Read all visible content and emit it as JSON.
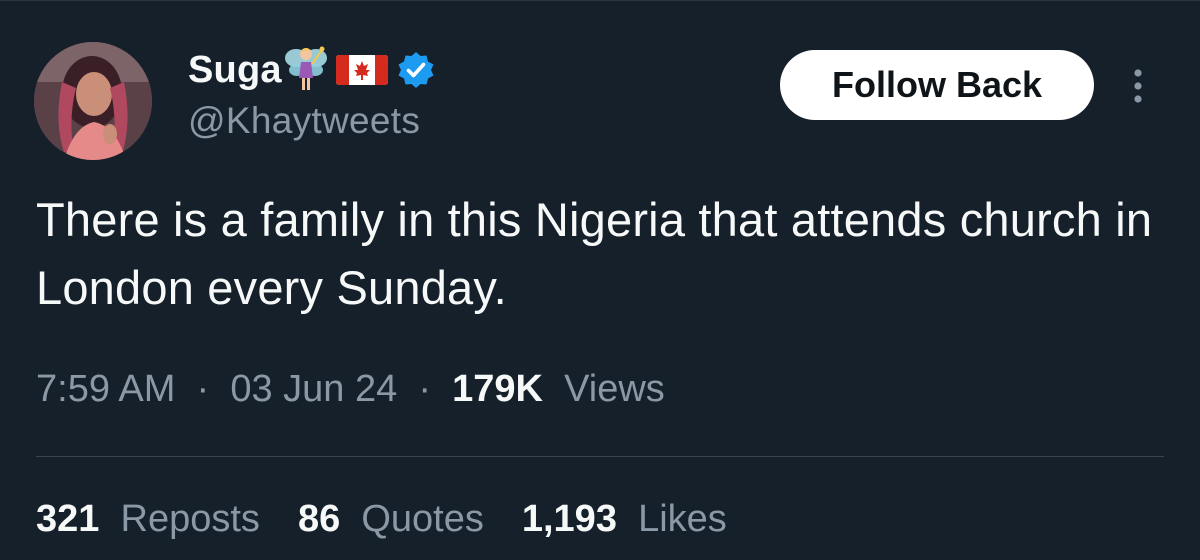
{
  "user": {
    "display_name": "Suga",
    "handle": "@Khaytweets",
    "emoji_icons": [
      "fairy-icon",
      "canada-flag-icon"
    ],
    "verified": true
  },
  "actions": {
    "follow_label": "Follow Back"
  },
  "tweet": {
    "text": "There is a family in this Nigeria that attends church in London every Sunday."
  },
  "meta": {
    "time": "7:59 AM",
    "separator": "·",
    "date": "03 Jun 24",
    "views_count": "179K",
    "views_label": "Views"
  },
  "stats": {
    "reposts_count": "321",
    "reposts_label": "Reposts",
    "quotes_count": "86",
    "quotes_label": "Quotes",
    "likes_count": "1,193",
    "likes_label": "Likes"
  },
  "colors": {
    "background": "#15202b",
    "primary_text": "#f7f9f9",
    "secondary_text": "#8b98a5",
    "verified_blue": "#1d9bf0",
    "button_bg": "#ffffff"
  }
}
